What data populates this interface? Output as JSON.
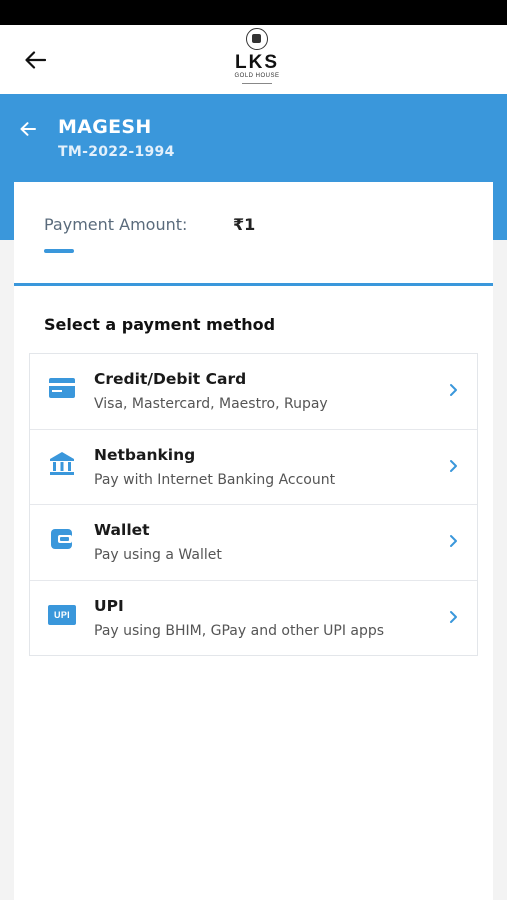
{
  "header": {
    "back_icon": "arrow-left-icon",
    "logo": {
      "brand": "LKS",
      "subtitle": "GOLD HOUSE"
    }
  },
  "customer": {
    "name": "MAGESH",
    "id": "TM-2022-1994"
  },
  "payment": {
    "amount_label": "Payment Amount:",
    "amount_value": "₹1"
  },
  "methods_section": {
    "title": "Select a payment method",
    "items": [
      {
        "title": "Credit/Debit Card",
        "description": "Visa, Mastercard, Maestro, Rupay",
        "icon": "credit-card-icon"
      },
      {
        "title": "Netbanking",
        "description": "Pay with Internet Banking Account",
        "icon": "bank-icon"
      },
      {
        "title": "Wallet",
        "description": "Pay using a Wallet",
        "icon": "wallet-icon"
      },
      {
        "title": "UPI",
        "description": "Pay using BHIM, GPay and other UPI apps",
        "icon": "upi-icon",
        "badge": "UPI"
      }
    ]
  },
  "colors": {
    "accent": "#3a97db",
    "status_bar": "#000000",
    "background": "#f3f3f3"
  }
}
